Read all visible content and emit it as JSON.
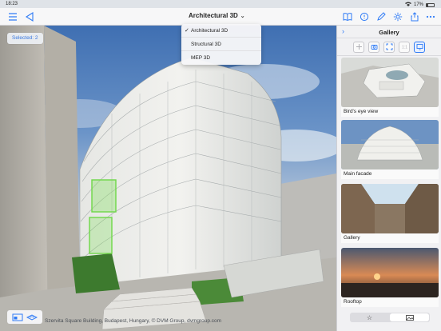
{
  "status": {
    "time": "18:23",
    "battery": "17%"
  },
  "toolbar": {
    "title": "Architectural 3D",
    "icons_left": [
      "list-icon",
      "back-triangle-icon"
    ],
    "icons_right": [
      "book-icon",
      "chat-icon",
      "pencil-icon",
      "gear-icon",
      "share-icon",
      "more-icon"
    ]
  },
  "dropdown": {
    "items": [
      {
        "label": "Architectural 3D",
        "checked": true
      },
      {
        "label": "Structural 3D",
        "checked": false
      },
      {
        "label": "MEP 3D",
        "checked": false
      }
    ]
  },
  "viewport": {
    "selected": "Selected: 2",
    "caption": "Szervita Square Building, Budapest, Hungary, © DVM Group, dvmgroup.com"
  },
  "gallery": {
    "title": "Gallery",
    "items": [
      {
        "label": "Bird's eye view"
      },
      {
        "label": "Main facade"
      },
      {
        "label": "Gallery"
      },
      {
        "label": "Rooftop"
      }
    ]
  },
  "colors": {
    "accent": "#2f7bf6",
    "selection": "#7fe05a"
  }
}
